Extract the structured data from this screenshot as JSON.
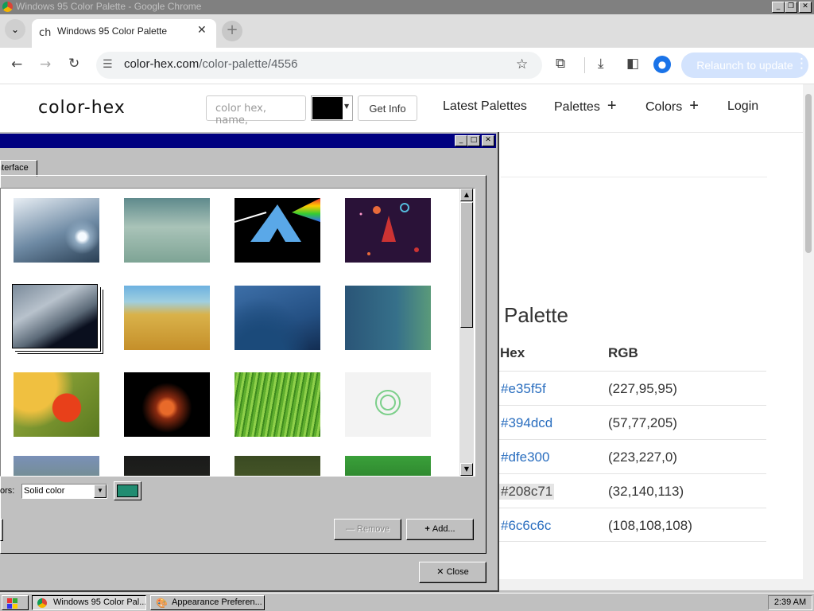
{
  "window": {
    "title": "Windows 95 Color Palette - Google Chrome"
  },
  "browser": {
    "tab_title": "Windows 95 Color Palette",
    "tab_favicon": "ch",
    "url_domain": "color-hex.com",
    "url_path": "/color-palette/4556",
    "relaunch_label": "Relaunch to update"
  },
  "site": {
    "brand": "color-hex",
    "search_placeholder": "color hex, name,",
    "get_info_label": "Get Info",
    "nav": {
      "latest": "Latest Palettes",
      "palettes": "Palettes",
      "colors": "Colors",
      "login": "Login"
    },
    "palette_title": "Palette",
    "table_headers": {
      "hex": "Hex",
      "rgb": "RGB"
    },
    "palette_rows": [
      {
        "hex": "#e35f5f",
        "rgb": "(227,95,95)"
      },
      {
        "hex": "#394dcd",
        "rgb": "(57,77,205)"
      },
      {
        "hex": "#dfe300",
        "rgb": "(223,227,0)"
      },
      {
        "hex": "#208c71",
        "rgb": "(32,140,113)"
      },
      {
        "hex": "#6c6c6c",
        "rgb": "(108,108,108)"
      }
    ]
  },
  "dialog": {
    "tab_label": "Interface",
    "colors_label": "ors:",
    "colors_select": "Solid color",
    "selected_color": "#208c71",
    "remove_label": "Remove",
    "add_label": "Add...",
    "close_label": "Close"
  },
  "taskbar": {
    "buttons": [
      "Windows 95 Color Pal...",
      "Appearance Preferen..."
    ],
    "clock": "2:39 AM"
  }
}
